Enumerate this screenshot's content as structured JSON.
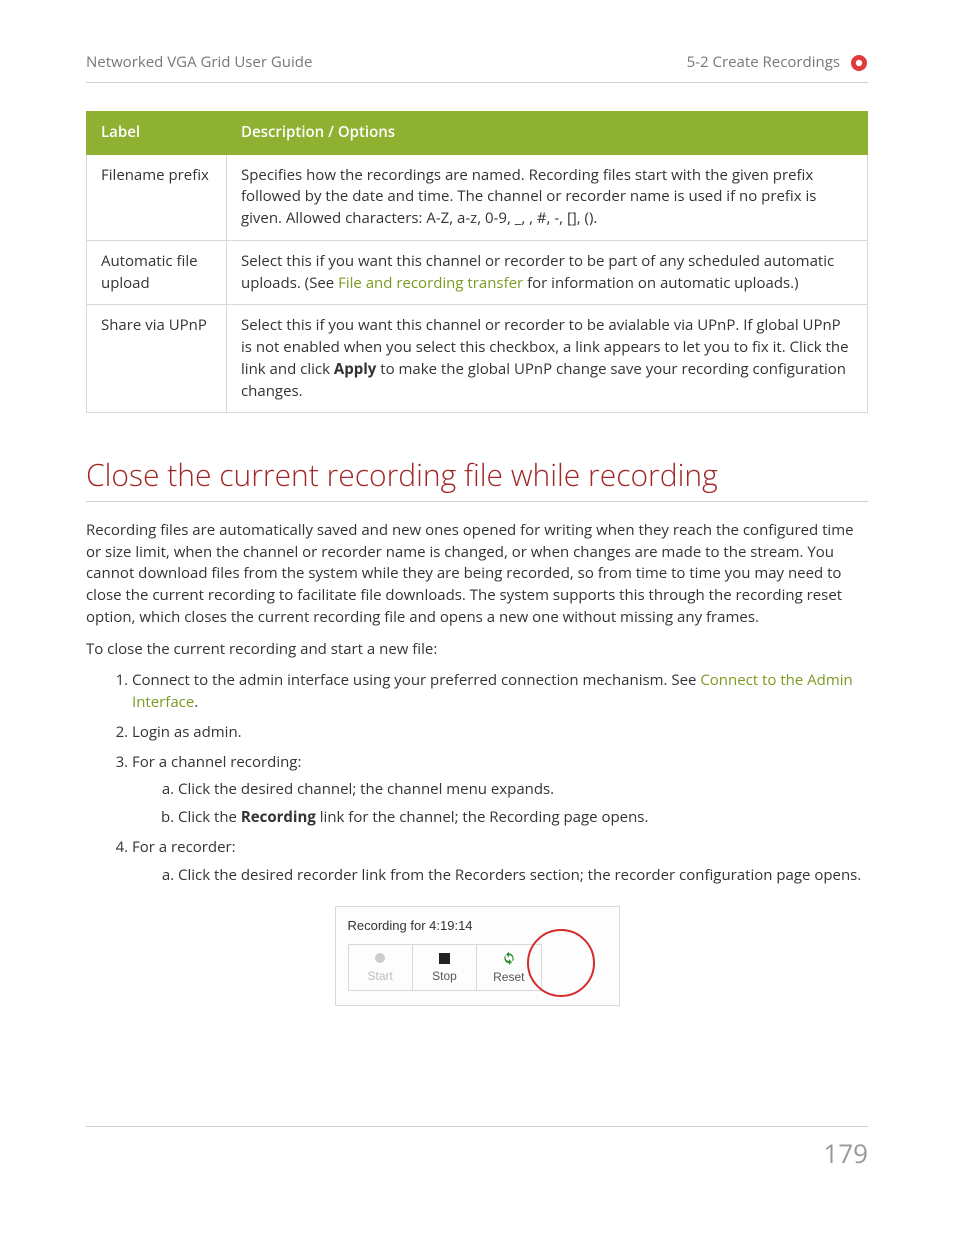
{
  "header": {
    "left": "Networked VGA Grid User Guide",
    "right": "5-2 Create Recordings"
  },
  "table": {
    "head": {
      "label": "Label",
      "desc": "Description / Options"
    },
    "rows": [
      {
        "label": "Filename prefix",
        "desc": "Specifies how the recordings are named. Recording files start with the given prefix followed by the date and time. The channel or recorder name is used if no prefix is given. Allowed characters: A-Z, a-z, 0-9, _, , #, -, [], ()."
      },
      {
        "label": "Automatic file upload",
        "desc_pre": "Select this if you want this channel or recorder to be part of any scheduled automatic uploads. (See ",
        "desc_link": "File and recording transfer",
        "desc_post": " for information on automatic uploads.)"
      },
      {
        "label": "Share via UPnP",
        "desc_pre": "Select this if you want this channel or recorder to be avialable via UPnP. If global UPnP is not enabled when you select this checkbox, a link appears to let you to fix it. Click the link and click ",
        "bold": "Apply",
        "desc_post": " to make the global UPnP change save your recording configuration changes."
      }
    ]
  },
  "section_title": "Close the current recording file while recording",
  "intro_p1": "Recording files are automatically saved and new ones opened for writing when they reach the configured time or size limit, when the channel or recorder name is changed, or when changes are made to the stream. You cannot download files from the system while they are being recorded, so from time to time you may need to close the current recording to facilitate file downloads. The system supports this through the recording reset option, which closes the current recording file and opens a new one without missing any frames.",
  "intro_p2": "To close the current recording and start a new file:",
  "steps": {
    "s1_pre": "Connect to the admin interface using your preferred connection mechanism. See ",
    "s1_link": "Connect to the Admin Interface",
    "s1_post": ".",
    "s2": "Login as admin.",
    "s3": "For a channel recording:",
    "s3a": "Click the desired channel; the channel menu expands.",
    "s3b_pre": "Click the ",
    "s3b_bold": "Recording",
    "s3b_post": " link for the channel; the Recording page opens.",
    "s4": "For a recorder:",
    "s4a": "Click the desired recorder link from the Recorders section; the recorder configuration page opens."
  },
  "figure": {
    "title": "Recording for 4:19:14",
    "btn_start": "Start",
    "btn_stop": "Stop",
    "btn_reset": "Reset"
  },
  "page_number": "179"
}
